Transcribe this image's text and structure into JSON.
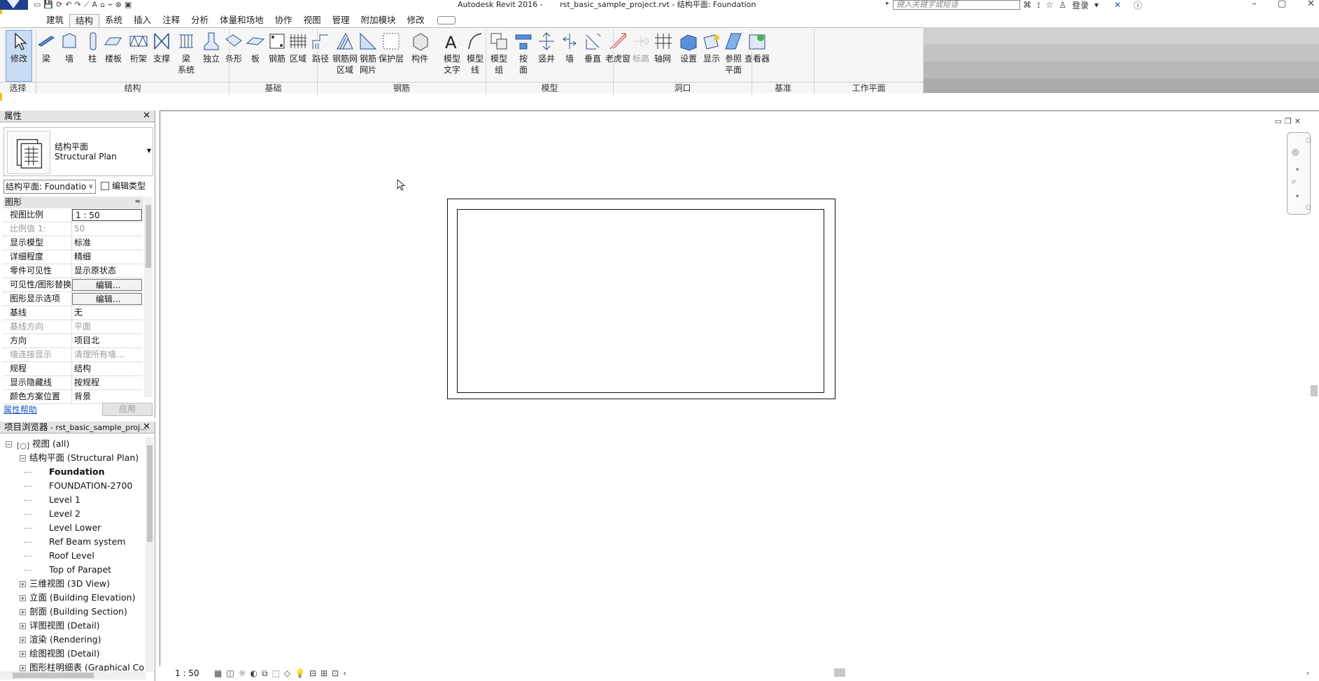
{
  "titlebar": {
    "title": "Autodesk Revit 2016 -       rst_basic_sample_project.rvt - 结构平面: Foundation",
    "search_placeholder": "键入关键字或短语",
    "login": "登录",
    "qat_icons": [
      "open-icon",
      "save-icon",
      "sync-icon",
      "undo-icon",
      "redo-icon",
      "measure-icon",
      "text-icon",
      "3d-view-icon",
      "section-icon",
      "close-hidden-icon",
      "switch-windows-icon"
    ]
  },
  "tabs": [
    "建筑",
    "结构",
    "系统",
    "插入",
    "注释",
    "分析",
    "体量和场地",
    "协作",
    "视图",
    "管理",
    "附加模块",
    "修改"
  ],
  "ribbon": {
    "modify": "修改",
    "tools": [
      {
        "label": "梁",
        "icon": "beam-icon"
      },
      {
        "label": "墙",
        "icon": "wall-icon"
      },
      {
        "label": "柱",
        "icon": "column-icon"
      },
      {
        "label": "楼板",
        "icon": "floor-icon"
      },
      {
        "label": "桁架",
        "icon": "truss-icon"
      },
      {
        "label": "支撑",
        "icon": "brace-icon"
      },
      {
        "label": "梁\n系统",
        "icon": "beam-system-icon"
      },
      {
        "label": "独立",
        "icon": "isolated-foundation-icon"
      },
      {
        "label": "条形",
        "icon": "wall-foundation-icon"
      },
      {
        "label": "板",
        "icon": "slab-foundation-icon"
      },
      {
        "label": "钢筋",
        "icon": "rebar-icon"
      },
      {
        "label": "区域",
        "icon": "area-rebar-icon"
      },
      {
        "label": "路径",
        "icon": "path-rebar-icon"
      },
      {
        "label": "钢筋网\n区域",
        "icon": "fabric-area-icon"
      },
      {
        "label": "钢筋\n网片",
        "icon": "fabric-sheet-icon"
      },
      {
        "label": "保护层",
        "icon": "cover-icon"
      },
      {
        "label": "构件",
        "icon": "component-icon"
      },
      {
        "label": "模型\n文字",
        "icon": "model-text-icon"
      },
      {
        "label": "模型\n线",
        "icon": "model-line-icon"
      },
      {
        "label": "模型\n组",
        "icon": "model-group-icon"
      },
      {
        "label": "按\n面",
        "icon": "by-face-icon"
      },
      {
        "label": "竖井",
        "icon": "shaft-icon"
      },
      {
        "label": "墙",
        "icon": "wall-opening-icon"
      },
      {
        "label": "垂直",
        "icon": "vertical-opening-icon"
      },
      {
        "label": "老虎窗",
        "icon": "dormer-icon"
      },
      {
        "label": "标高",
        "icon": "level-icon"
      },
      {
        "label": "轴网",
        "icon": "grid-icon"
      },
      {
        "label": "设置",
        "icon": "set-workplane-icon"
      },
      {
        "label": "显示",
        "icon": "show-workplane-icon"
      },
      {
        "label": "参照\n平面",
        "icon": "ref-plane-icon"
      },
      {
        "label": "查看器",
        "icon": "viewer-icon"
      }
    ],
    "panels": [
      "选择",
      "结构",
      "基础",
      "钢筋",
      "模型",
      "洞口",
      "基准",
      "工作平面"
    ]
  },
  "properties": {
    "title": "属性",
    "type_name_cn": "结构平面",
    "type_name_en": "Structural Plan",
    "instance_select": "结构平面: Foundatio",
    "edit_type": "编辑类型",
    "group": "图形",
    "rows": [
      {
        "name": "视图比例",
        "value": "1 : 50",
        "style": "boxed"
      },
      {
        "name": "比例值 1:",
        "value": "50",
        "style": "dim"
      },
      {
        "name": "显示模型",
        "value": "标准",
        "style": ""
      },
      {
        "name": "详细程度",
        "value": "精细",
        "style": ""
      },
      {
        "name": "零件可见性",
        "value": "显示原状态",
        "style": ""
      },
      {
        "name": "可见性/图形替换",
        "value": "编辑...",
        "style": "btn"
      },
      {
        "name": "图形显示选项",
        "value": "编辑...",
        "style": "btn"
      },
      {
        "name": "基线",
        "value": "无",
        "style": ""
      },
      {
        "name": "基线方向",
        "value": "平面",
        "style": "dim"
      },
      {
        "name": "方向",
        "value": "项目北",
        "style": ""
      },
      {
        "name": "墙连接显示",
        "value": "清理所有墙...",
        "style": "dim"
      },
      {
        "name": "规程",
        "value": "结构",
        "style": ""
      },
      {
        "name": "显示隐藏线",
        "value": "按规程",
        "style": ""
      },
      {
        "name": "颜色方案位置",
        "value": "背景",
        "style": ""
      }
    ],
    "help": "属性帮助",
    "apply": "应用"
  },
  "browser": {
    "title": "项目浏览器",
    "subtitle": " - rst_basic_sample_proj...",
    "tree": [
      {
        "label": "视图 (all)",
        "level": 0,
        "toggle": "⊟",
        "bold": false
      },
      {
        "label": "结构平面 (Structural Plan)",
        "level": 1,
        "toggle": "⊟",
        "bold": false
      },
      {
        "label": "Foundation",
        "level": 2,
        "toggle": "",
        "bold": true
      },
      {
        "label": "FOUNDATION-2700",
        "level": 2,
        "toggle": "",
        "bold": false
      },
      {
        "label": "Level 1",
        "level": 2,
        "toggle": "",
        "bold": false
      },
      {
        "label": "Level 2",
        "level": 2,
        "toggle": "",
        "bold": false
      },
      {
        "label": "Level Lower",
        "level": 2,
        "toggle": "",
        "bold": false
      },
      {
        "label": "Ref Beam system",
        "level": 2,
        "toggle": "",
        "bold": false
      },
      {
        "label": "Roof Level",
        "level": 2,
        "toggle": "",
        "bold": false
      },
      {
        "label": "Top of Parapet",
        "level": 2,
        "toggle": "",
        "bold": false
      },
      {
        "label": "三维视图 (3D View)",
        "level": 1,
        "toggle": "⊞",
        "bold": false
      },
      {
        "label": "立面 (Building Elevation)",
        "level": 1,
        "toggle": "⊞",
        "bold": false
      },
      {
        "label": "剖面 (Building Section)",
        "level": 1,
        "toggle": "⊞",
        "bold": false
      },
      {
        "label": "详图视图 (Detail)",
        "level": 1,
        "toggle": "⊞",
        "bold": false
      },
      {
        "label": "渲染 (Rendering)",
        "level": 1,
        "toggle": "⊞",
        "bold": false
      },
      {
        "label": "绘图视图 (Detail)",
        "level": 1,
        "toggle": "⊞",
        "bold": false
      },
      {
        "label": "图形柱明细表 (Graphical Co",
        "level": 1,
        "toggle": "⊞",
        "bold": false
      }
    ]
  },
  "view_bar": {
    "scale": "1 : 50"
  }
}
